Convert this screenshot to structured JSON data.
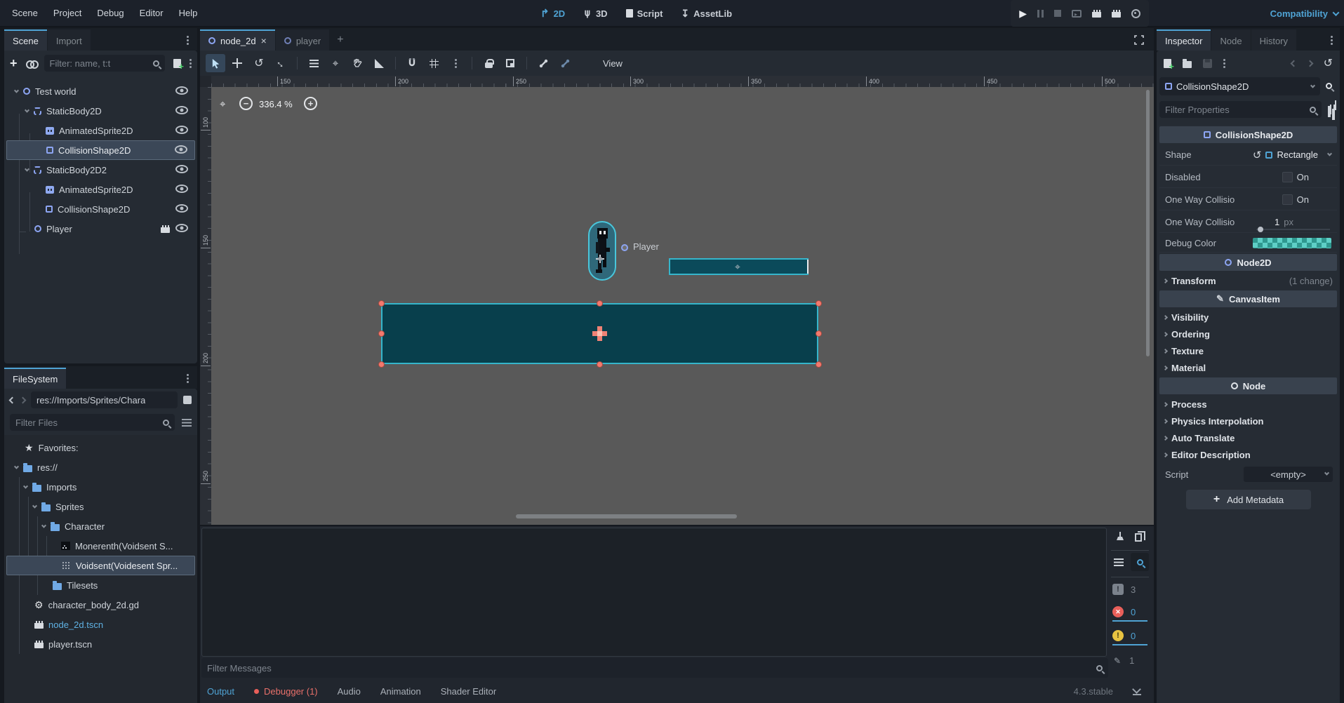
{
  "menubar": {
    "items": [
      "Scene",
      "Project",
      "Debug",
      "Editor",
      "Help"
    ]
  },
  "context_switcher": {
    "tabs": [
      {
        "label": "2D"
      },
      {
        "label": "3D"
      },
      {
        "label": "Script"
      },
      {
        "label": "AssetLib"
      }
    ]
  },
  "renderer": {
    "label": "Compatibility"
  },
  "scene_dock": {
    "tabs": [
      {
        "label": "Scene"
      },
      {
        "label": "Import"
      }
    ],
    "filter_placeholder": "Filter: name, t:t",
    "tree": [
      {
        "label": "Test world",
        "icon": "node2d-icon"
      },
      {
        "label": "StaticBody2D",
        "icon": "staticbody2d-icon"
      },
      {
        "label": "AnimatedSprite2D",
        "icon": "animatedsprite2d-icon"
      },
      {
        "label": "CollisionShape2D",
        "icon": "collisionshape2d-icon"
      },
      {
        "label": "StaticBody2D2",
        "icon": "staticbody2d-icon"
      },
      {
        "label": "AnimatedSprite2D",
        "icon": "animatedsprite2d-icon"
      },
      {
        "label": "CollisionShape2D",
        "icon": "collisionshape2d-icon"
      },
      {
        "label": "Player",
        "icon": "node2d-icon"
      }
    ]
  },
  "filesystem_dock": {
    "tab_label": "FileSystem",
    "path": "res://Imports/Sprites/Chara",
    "filter_placeholder": "Filter Files",
    "tree": [
      {
        "label": "Favorites:",
        "icon": "star-icon"
      },
      {
        "label": "res://",
        "icon": "folder-icon"
      },
      {
        "label": "Imports",
        "icon": "folder-icon"
      },
      {
        "label": "Sprites",
        "icon": "folder-icon"
      },
      {
        "label": "Character",
        "icon": "folder-icon"
      },
      {
        "label": "Monerenth(Voidsent S...",
        "icon": "image-file-icon"
      },
      {
        "label": "Voidsent(Voidesent Spr...",
        "icon": "image-file-icon"
      },
      {
        "label": "Tilesets",
        "icon": "folder-icon"
      },
      {
        "label": "character_body_2d.gd",
        "icon": "gdscript-icon"
      },
      {
        "label": "node_2d.tscn",
        "icon": "scene-icon"
      },
      {
        "label": "player.tscn",
        "icon": "scene-icon"
      }
    ]
  },
  "scene_tabs": {
    "tabs": [
      {
        "label": "node_2d"
      },
      {
        "label": "player"
      }
    ]
  },
  "canvas_toolbar": {
    "view_label": "View"
  },
  "viewport": {
    "zoom_level": "336.4 %",
    "player_label": "Player",
    "ruler_top": [
      "150",
      "200",
      "250",
      "300",
      "350",
      "400",
      "450",
      "500"
    ],
    "ruler_left": [
      "100",
      "150",
      "200",
      "250"
    ]
  },
  "inspector": {
    "tabs": [
      {
        "label": "Inspector"
      },
      {
        "label": "Node"
      },
      {
        "label": "History"
      }
    ],
    "object_name": "CollisionShape2D",
    "filter_placeholder": "Filter Properties",
    "rows": [
      {
        "type": "category",
        "label": "CollisionShape2D"
      },
      {
        "type": "property",
        "label": "Shape",
        "value": "Rectangle"
      },
      {
        "type": "property",
        "label": "Disabled",
        "value": "On"
      },
      {
        "type": "property",
        "label": "One Way Collisio",
        "value": "On"
      },
      {
        "type": "property",
        "label": "One Way Collisio",
        "value": "1",
        "suffix": "px"
      },
      {
        "type": "property",
        "label": "Debug Color"
      },
      {
        "type": "category",
        "label": "Node2D"
      },
      {
        "type": "group",
        "label": "Transform",
        "extra": "(1 change)"
      },
      {
        "type": "category",
        "label": "CanvasItem"
      },
      {
        "type": "group",
        "label": "Visibility"
      },
      {
        "type": "group",
        "label": "Ordering"
      },
      {
        "type": "group",
        "label": "Texture"
      },
      {
        "type": "group",
        "label": "Material"
      },
      {
        "type": "category",
        "label": "Node"
      },
      {
        "type": "group",
        "label": "Process"
      },
      {
        "type": "group",
        "label": "Physics Interpolation"
      },
      {
        "type": "group",
        "label": "Auto Translate"
      },
      {
        "type": "group",
        "label": "Editor Description"
      },
      {
        "type": "property",
        "label": "Script",
        "value": "<empty>"
      }
    ],
    "add_metadata_label": "Add Metadata"
  },
  "bottom_panel": {
    "filter_placeholder": "Filter Messages",
    "counts": {
      "messages": "3",
      "errors": "0",
      "warnings": "0",
      "edited": "1"
    }
  },
  "bottom_bar": {
    "tabs": [
      {
        "label": "Output"
      },
      {
        "label": "Debugger (1)"
      },
      {
        "label": "Audio"
      },
      {
        "label": "Animation"
      },
      {
        "label": "Shader Editor"
      }
    ],
    "version": "4.3.stable"
  },
  "colors": {
    "accent": "#4fa3d4",
    "selection": "#3b4757",
    "canvas_bg": "#595959",
    "shape_fill": "#083f4c",
    "shape_border": "#35b5cb",
    "handle": "#f4786d",
    "error": "#e95f5a",
    "warning": "#e8c341",
    "node_icon": "#8da5f3",
    "folder_icon": "#70a9e5"
  }
}
